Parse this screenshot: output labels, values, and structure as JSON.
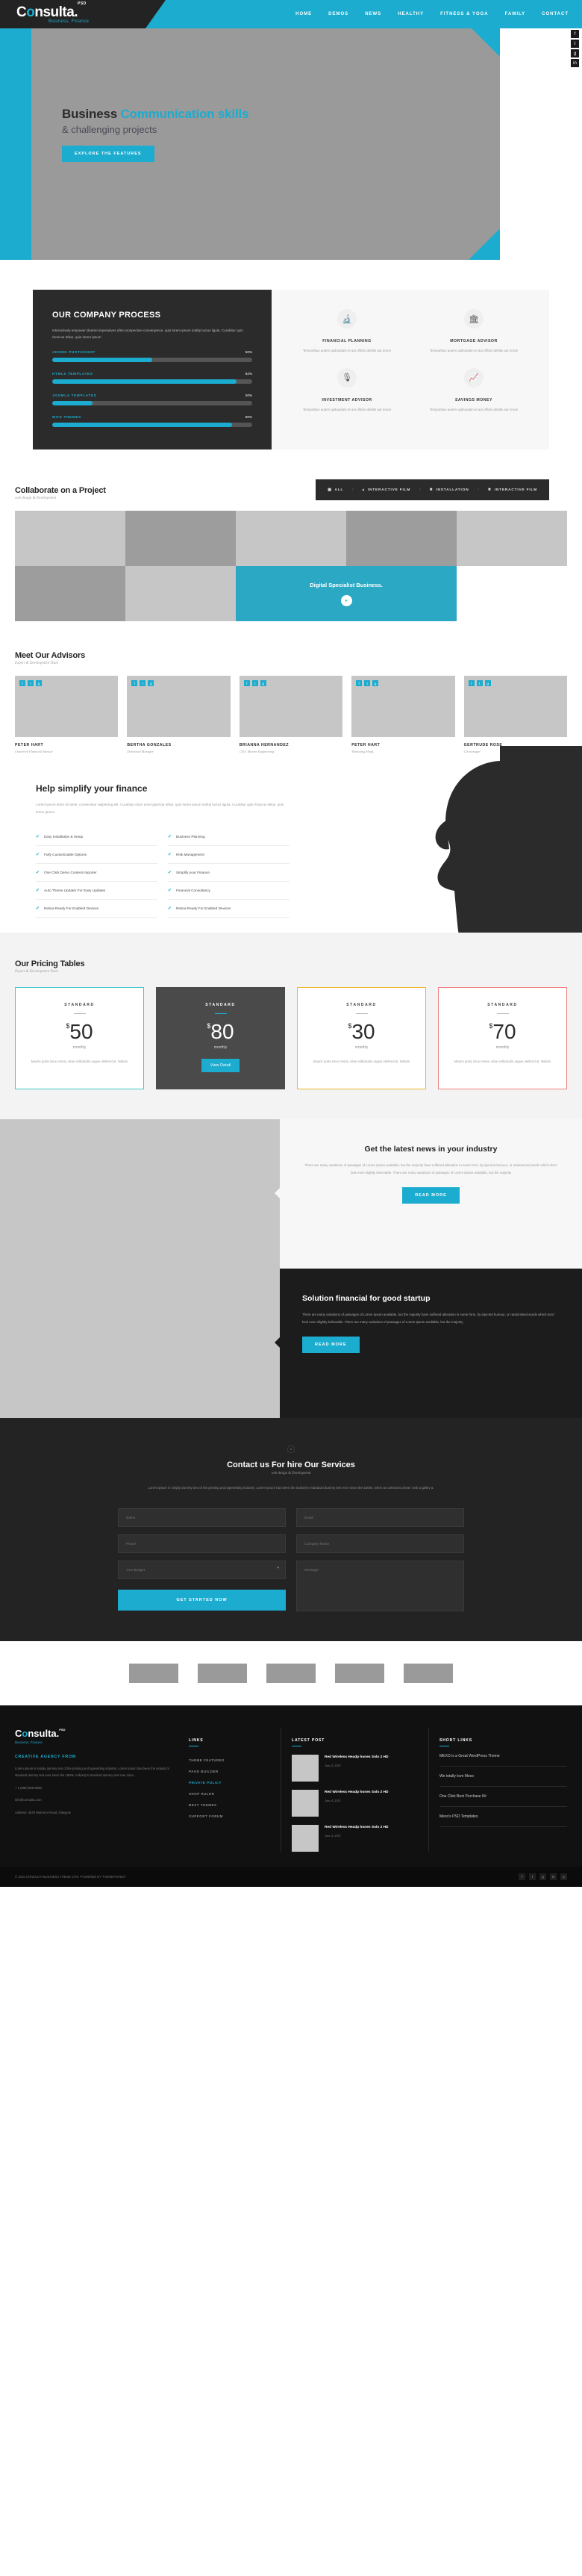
{
  "brand": {
    "name_pre": "C",
    "name_o": "o",
    "name_post": "nsulta.",
    "psd": "PSD",
    "tagline": "Business, Finance"
  },
  "nav": {
    "items": [
      "HOME",
      "DEMOS",
      "NEWS",
      "HEALTHY",
      "FITNESS & YOGA",
      "FAMILY",
      "CONTACT"
    ]
  },
  "social_rail": [
    "f",
    "t",
    "g",
    "in"
  ],
  "hero": {
    "title_dark": "Business ",
    "title_accent": "Communication skills",
    "subtitle": "& challenging projects",
    "cta": "EXPLORE THE FEATURES"
  },
  "process": {
    "title": "OUR COMPANY PROCESS",
    "desc": "Interactively empower diverse imperatives after prospective convergence. quis lorem ipsum tooltip luctus ligula. Curabitur quis rhoncus tellus, quis lorem ipsum",
    "bars": [
      {
        "label": "ADOBE PHOTOSHOP",
        "value": "50%",
        "pct": 50
      },
      {
        "label": "HTML5 TEMPLATES",
        "value": "92%",
        "pct": 92
      },
      {
        "label": "JOOMLA TEMPLATES",
        "value": "20%",
        "pct": 20
      },
      {
        "label": "WOO THEMES",
        "value": "90%",
        "pct": 90
      }
    ]
  },
  "services": [
    {
      "icon": "microscope-icon",
      "glyph": "🔬",
      "name": "FINANCIAL PLANNING",
      "text": "Temporibus autem quibusdam et aut officiis debitis aut rerum"
    },
    {
      "icon": "bank-icon",
      "glyph": "🏛",
      "name": "MORTGAGE ADVISOR",
      "text": "Temporibus autem quibusdam et aut officiis debitis aut rerum"
    },
    {
      "icon": "microphone-icon",
      "glyph": "🎙",
      "name": "INVESTMENT ADVISOR",
      "text": "Temporibus autem quibusdam et aut officiis debitis aut rerum"
    },
    {
      "icon": "presentation-chart-icon",
      "glyph": "📈",
      "name": "SAVINGS MONEY",
      "text": "Temporibus autem quibusdam et aut officiis debitis aut rerum"
    }
  ],
  "portfolio": {
    "title": "Collaborate on a Project",
    "subtitle": "web design & Development",
    "filters": [
      "ALL",
      "INTERACTIVE FILM",
      "INSTALLATION",
      "INTERACTIVE FILM"
    ],
    "feature_caption": "Digital Specialist Business.",
    "feature_plus": "+"
  },
  "team": {
    "title": "Meet Our Advisors",
    "subtitle": "Expert & Development Team",
    "members": [
      {
        "name": "PETER HART",
        "role": "Chartered Financial Advisor"
      },
      {
        "name": "BERTHA GONZALES",
        "role": "Divisional Manager"
      },
      {
        "name": "BRIANNA HERNANDEZ",
        "role": "CEO, Marine Engineering"
      },
      {
        "name": "PETER HART",
        "role": "Marketing Head,"
      },
      {
        "name": "GERTRUDE ROSE",
        "role": "CA manager"
      }
    ],
    "social": [
      "f",
      "t",
      "g"
    ]
  },
  "features": {
    "title": "Help simplify your finance",
    "desc": "Lorem ipsum dolor sit amet, consectetur adipiscing elit. Curabitur dolor amet glavrida tellus, quis lorem ipsum tooltip luctus ligula. Curabitur quis rhoncus tellus, quis lorem ipsum",
    "left_items": [
      "Easy Installation & Setup",
      "Fully Customizable Options",
      "One Click Demo Content Importer",
      "Auto Theme Updater For Easy Updates",
      "Retina Ready For Enabled Devices"
    ],
    "right_items": [
      "Business Planning",
      "Risk Management",
      "Simplify your Finance",
      "Financial Consultancy",
      "Retina Ready For Enabled Devices"
    ],
    "check": "✔"
  },
  "pricing": {
    "title": "Our Pricing Tables",
    "subtitle": "Expert & Development Team",
    "plans": [
      {
        "name": "STANDARD",
        "currency": "$",
        "price": "50",
        "per": "monthly",
        "text": "Mauris porta risus metus, vitae sollicitudin augue eleifend at. Nullam",
        "button": ""
      },
      {
        "name": "STANDARD",
        "currency": "$",
        "price": "80",
        "per": "monthly",
        "text": "",
        "button": "View Detail"
      },
      {
        "name": "STANDARD",
        "currency": "$",
        "price": "30",
        "per": "monthly",
        "text": "Mauris porta risus metus, vitae sollicitudin augue eleifend at. Nullam",
        "button": ""
      },
      {
        "name": "STANDARD",
        "currency": "$",
        "price": "70",
        "per": "monthly",
        "text": "Mauris porta risus metus, vitae sollicitudin augue eleifend at. Nullam",
        "button": ""
      }
    ]
  },
  "news": {
    "title": "Get the latest news in your industry",
    "text": "There are many variations of passages of Lorem Ipsum available, but the majority have suffered alteration in some form, by injected humour, or randomised words which don't look even slightly believable. There are many variations of passages of Lorem Ipsum available, but the majority",
    "cta": "READ MORE"
  },
  "startup": {
    "title": "Solution financial for good startup",
    "text": "There are many variations of passages of Lorem Ipsum available, but the majority have suffered alteration in some form, by injected humour, or randomised words which don't look even slightly believable. There are many variations of passages of Lorem Ipsum available, but the majority",
    "cta": "READ MORE"
  },
  "contact": {
    "icon": "support-icon",
    "title": "Contact us For hire Our Services",
    "subtitle": "web design & Development",
    "desc": "Lorem ipsum is simply dummy text of the printing and typesetting industry. Lorem Ipsum has been the industry's standard dummy text ever since the 1500s, when an unknown printer took a galley a.",
    "fields": {
      "name_placeholder": "Name",
      "email_placeholder": "Email",
      "phone_placeholder": "Phone",
      "company_placeholder": "Company Name",
      "budget_placeholder": "Your Budget",
      "message_placeholder": "Message"
    },
    "submit": "GET STARTED NOW"
  },
  "clients": [
    "client-logo-1",
    "client-logo-2",
    "client-logo-3",
    "client-logo-4",
    "client-logo-5"
  ],
  "footer": {
    "logo_pre": "C",
    "logo_o": "o",
    "logo_post": "nsulta.",
    "logo_psd": "PSD",
    "logo_sub": "Business, Finance",
    "about_head": "CREATIVE AGENCY FROM",
    "about_text": "Lorem ipsum is simply dummy text of the printing and typesetting industry. Lorem Ipsum has been the industry's standard dummy text ever since the 1500s. Industry's standard dummy text ever since.",
    "contact_lines": [
      "+ 1 (888) 888-8888",
      "info@consulta.com",
      "Address: 4578 Marmora Road, Glasgow"
    ],
    "links_head": "LINKS",
    "links": [
      "THEME FEATURES",
      "PAGE BUILDER",
      "PRIVATE POLICY",
      "SHOP RULER",
      "BEST THEMES",
      "SUPPORT FORUM"
    ],
    "links_active_index": 2,
    "posts_head": "LATEST POST",
    "posts": [
      {
        "title": "Red Wireless Headp hones Solo 2 HD",
        "date": "June 4, 2015"
      },
      {
        "title": "Red Wireless Headp hones Solo 2 HD",
        "date": "June 4, 2015"
      },
      {
        "title": "Red Wireless Headp hones Solo 2 HD",
        "date": "June 4, 2015"
      }
    ],
    "short_head": "SHORT LINKS",
    "short_links": [
      "MEXO is a Great WordPress Theme",
      "We totally love Mexo",
      "One Click Best Purchase Kit",
      "Mexo's PSD Templates"
    ],
    "copyright": "© 2015 CONSULTA BUSINESS THEME SITE. POWERED BY THEMEFOREST",
    "social": [
      "f",
      "t",
      "g",
      "in",
      "p"
    ]
  },
  "colors": {
    "accent": "#1bacd0",
    "dark": "#232323",
    "teal": "#3fc8c8",
    "amber": "#f0b429",
    "coral": "#ef7f7f"
  }
}
